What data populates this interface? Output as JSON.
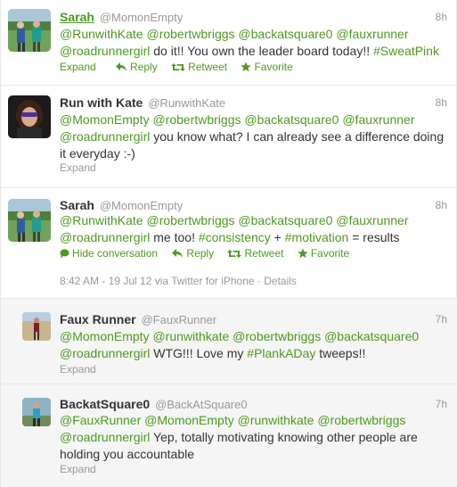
{
  "tweets": [
    {
      "fullname": "Sarah",
      "username": "@MomonEmpty",
      "time": "8h",
      "line1": [
        "@RunwithKate",
        "@robertwbriggs",
        "@backatsquare0",
        "@fauxrunner"
      ],
      "line2_mention": "@roadrunnergirl",
      "line2_text": " do it!! You own the leader board today!! ",
      "line2_tag": "#SweatPink",
      "actions": {
        "expand": "Expand",
        "reply": "Reply",
        "retweet": "Retweet",
        "favorite": "Favorite"
      }
    },
    {
      "fullname": "Run with Kate",
      "username": "@RunwithKate",
      "time": "8h",
      "line1": [
        "@MomonEmpty",
        "@robertwbriggs",
        "@backatsquare0",
        "@fauxrunner"
      ],
      "line2_mention": "@roadrunnergirl",
      "line2_text": " you know what? I can already see a difference doing",
      "line3_text": "it everyday :-)",
      "expand": "Expand"
    },
    {
      "fullname": "Sarah",
      "username": "@MomonEmpty",
      "time": "8h",
      "line1": [
        "@RunwithKate",
        "@robertwbriggs",
        "@backatsquare0",
        "@fauxrunner"
      ],
      "line2_mention": "@roadrunnergirl",
      "line2_text_a": " me too! ",
      "line2_tag1": "#consistency",
      "line2_text_b": " + ",
      "line2_tag2": "#motivation",
      "line2_text_c": " = results",
      "actions": {
        "hide": "Hide conversation",
        "reply": "Reply",
        "retweet": "Retweet",
        "favorite": "Favorite"
      },
      "meta_date": "8:42 AM - 19 Jul 12",
      "meta_via": " via Twitter for iPhone",
      "meta_sep": " · ",
      "meta_details": "Details"
    },
    {
      "fullname": "Faux Runner",
      "username": "@FauxRunner",
      "time": "7h",
      "line1": [
        "@MomonEmpty",
        "@runwithkate",
        "@robertwbriggs",
        "@backatsquare0"
      ],
      "line2_mention": "@roadrunnergirl",
      "line2_text_a": " WTG!!! Love my ",
      "line2_tag": "#PlankADay",
      "line2_text_b": " tweeps!!",
      "expand": "Expand"
    },
    {
      "fullname": "BackatSquare0",
      "username": "@BackAtSquare0",
      "time": "7h",
      "line1": [
        "@FauxRunner",
        "@MomonEmpty",
        "@runwithkate",
        "@robertwbriggs"
      ],
      "line2_mention": "@roadrunnergirl",
      "line2_text": " Yep, totally motivating knowing other people are",
      "line3_text": "holding you accountable",
      "expand": "Expand"
    }
  ],
  "colors": {
    "link": "#4a9d1c",
    "muted": "#999999",
    "text": "#333333",
    "border": "#e8e8e8"
  },
  "icons": {
    "reply": "reply-arrow-icon",
    "retweet": "retweet-icon",
    "favorite": "star-icon",
    "conversation": "speech-bubble-icon"
  }
}
